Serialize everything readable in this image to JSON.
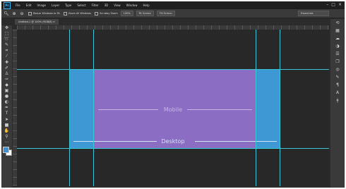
{
  "menubar": {
    "logo": "Ps",
    "items": [
      "File",
      "Edit",
      "Image",
      "Layer",
      "Type",
      "Select",
      "Filter",
      "3D",
      "View",
      "Window",
      "Help"
    ],
    "controls": [
      "–",
      "□",
      "×"
    ]
  },
  "optionsbar": {
    "resize_windows": "Resize Windows to Fit",
    "zoom_all": "Zoom All Windows",
    "scrubby_zoom": "Scrubby Zoom",
    "zoom_pct": "100%",
    "fit_screen": "Fit Screen",
    "fill_screen": "Fill Screen",
    "workspace": "Essentials"
  },
  "document": {
    "tab_title": "Untitled-1 @ 100% (RGB/8) ×"
  },
  "canvas": {
    "mobile_label": "Mobile",
    "desktop_label": "Desktop",
    "colors": {
      "background": "#282828",
      "desktop_area": "#3e98d3",
      "mobile_area": "#8b6ec4",
      "guides": "#39c6d6"
    }
  },
  "toolbar": {
    "tools": [
      "move-icon",
      "marquee-icon",
      "lasso-icon",
      "quick-select-icon",
      "crop-icon",
      "eyedropper-icon",
      "healing-icon",
      "brush-icon",
      "stamp-icon",
      "history-brush-icon",
      "eraser-icon",
      "gradient-icon",
      "blur-icon",
      "dodge-icon",
      "pen-icon",
      "type-icon",
      "path-select-icon",
      "shape-icon",
      "hand-icon",
      "zoom-icon",
      "more-icon"
    ],
    "foreground_color": "#3d8fd0",
    "background_color": "#ffffff"
  },
  "right_panel": {
    "icons": [
      "history-icon",
      "swatches-icon",
      "libraries-icon",
      "adjustments-icon",
      "properties-icon",
      "layers-icon",
      "channels-icon",
      "paths-icon",
      "paragraph-icon",
      "character-icon",
      "glyphs-icon"
    ]
  }
}
